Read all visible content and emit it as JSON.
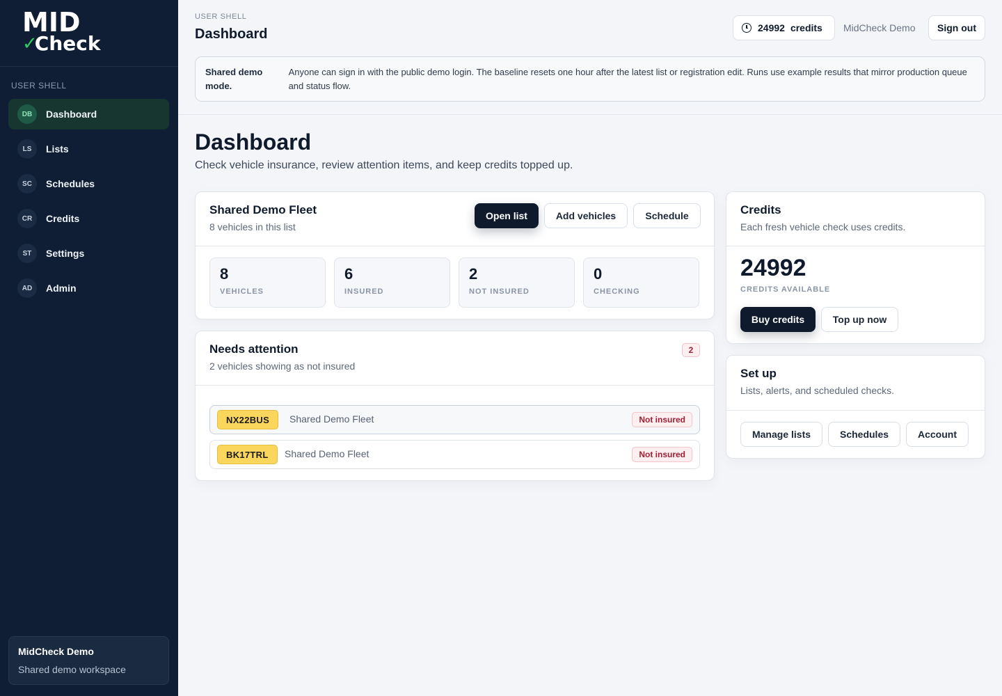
{
  "brand": {
    "logo_top": "MID",
    "logo_bottom": "Check",
    "logo_tick": "✓"
  },
  "sidebar": {
    "section_label": "USER SHELL",
    "items": [
      {
        "abbr": "DB",
        "label": "Dashboard",
        "active": true
      },
      {
        "abbr": "LS",
        "label": "Lists"
      },
      {
        "abbr": "SC",
        "label": "Schedules"
      },
      {
        "abbr": "CR",
        "label": "Credits"
      },
      {
        "abbr": "ST",
        "label": "Settings"
      },
      {
        "abbr": "AD",
        "label": "Admin"
      }
    ],
    "workspace": {
      "name": "MidCheck Demo",
      "subtitle": "Shared demo workspace"
    }
  },
  "header": {
    "eyebrow": "USER SHELL",
    "title": "Dashboard",
    "credits_value": "24992",
    "credits_label": "credits",
    "user_name": "MidCheck Demo",
    "sign_out": "Sign out"
  },
  "notice": {
    "label": "Shared demo mode.",
    "text": "Anyone can sign in with the public demo login. The baseline resets one hour after the latest list or registration edit. Runs use example results that mirror production queue and status flow."
  },
  "page": {
    "title": "Dashboard",
    "subtitle": "Check vehicle insurance, review attention items, and keep credits topped up."
  },
  "fleet": {
    "title": "Shared Demo Fleet",
    "subtitle": "8 vehicles in this list",
    "buttons": {
      "open": "Open list",
      "add": "Add vehicles",
      "schedule": "Schedule"
    },
    "stats": [
      {
        "value": "8",
        "label": "VEHICLES"
      },
      {
        "value": "6",
        "label": "INSURED"
      },
      {
        "value": "2",
        "label": "NOT INSURED"
      },
      {
        "value": "0",
        "label": "CHECKING"
      }
    ]
  },
  "attention": {
    "title": "Needs attention",
    "subtitle": "2 vehicles showing as not insured",
    "count": "2",
    "rows": [
      {
        "plate": "NX22BUS",
        "list": "Shared Demo Fleet",
        "status": "Not insured"
      },
      {
        "plate": "BK17TRL",
        "list": "Shared Demo Fleet",
        "status": "Not insured"
      }
    ]
  },
  "credits": {
    "title": "Credits",
    "subtitle": "Each fresh vehicle check uses credits.",
    "value": "24992",
    "value_label": "CREDITS AVAILABLE",
    "buy": "Buy credits",
    "top_up": "Top up now"
  },
  "setup": {
    "title": "Set up",
    "subtitle": "Lists, alerts, and scheduled checks.",
    "buttons": {
      "lists": "Manage lists",
      "schedules": "Schedules",
      "account": "Account"
    }
  }
}
